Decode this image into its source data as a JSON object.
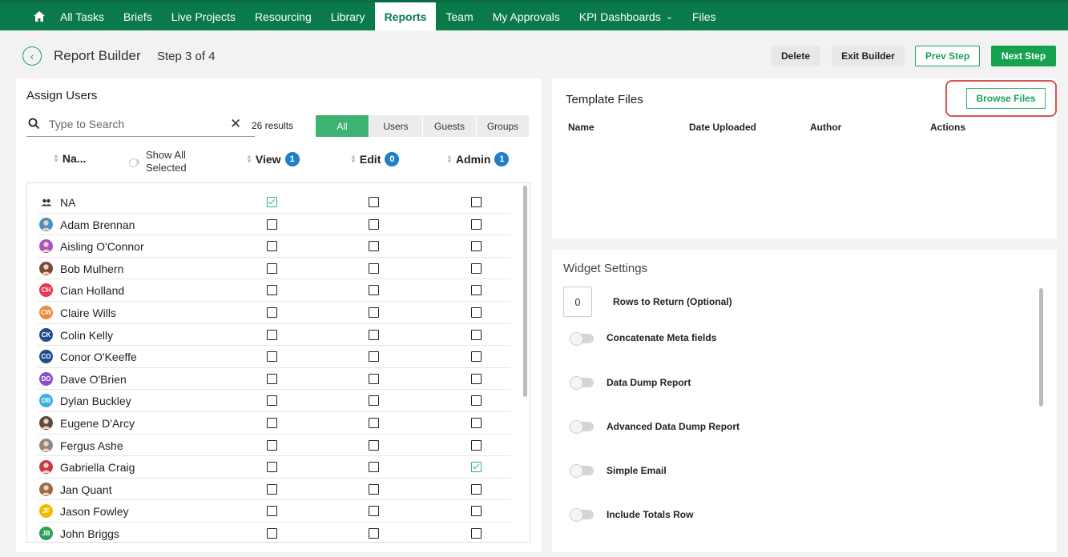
{
  "nav": {
    "home_icon": "home-icon",
    "items": [
      "All Tasks",
      "Briefs",
      "Live Projects",
      "Resourcing",
      "Library",
      "Reports",
      "Team",
      "My Approvals",
      "KPI Dashboards",
      "Files"
    ],
    "active": "Reports",
    "accent": "#0b7a4b"
  },
  "header": {
    "title": "Report Builder",
    "step": "Step 3 of 4",
    "delete_label": "Delete",
    "exit_label": "Exit Builder",
    "prev_label": "Prev Step",
    "next_label": "Next Step"
  },
  "assign": {
    "title": "Assign Users",
    "search_placeholder": "Type to Search",
    "results": "26 results",
    "filters": [
      "All",
      "Users",
      "Guests",
      "Groups"
    ],
    "columns": {
      "name": "Na...",
      "show_all": "Show All Selected",
      "view": "View",
      "view_count": "1",
      "edit": "Edit",
      "edit_count": "0",
      "admin": "Admin",
      "admin_count": "1"
    },
    "rows": [
      {
        "name": "NA",
        "initials": "",
        "color": "#444444",
        "group": true,
        "view": true,
        "edit": false,
        "admin": false
      },
      {
        "name": "Adam Brennan",
        "initials": "",
        "color": "#4a90c2",
        "view": false,
        "edit": false,
        "admin": false
      },
      {
        "name": "Aisling O'Connor",
        "initials": "",
        "color": "#a855c8",
        "view": false,
        "edit": false,
        "admin": false
      },
      {
        "name": "Bob Mulhern",
        "initials": "",
        "color": "#7a4b3a",
        "view": false,
        "edit": false,
        "admin": false
      },
      {
        "name": "Cian Holland",
        "initials": "CH",
        "color": "#e8384f",
        "view": false,
        "edit": false,
        "admin": false
      },
      {
        "name": "Claire Wills",
        "initials": "CW",
        "color": "#f0883e",
        "view": false,
        "edit": false,
        "admin": false
      },
      {
        "name": "Colin Kelly",
        "initials": "CK",
        "color": "#1e4f8c",
        "view": false,
        "edit": false,
        "admin": false
      },
      {
        "name": "Conor O'Keeffe",
        "initials": "CO",
        "color": "#1e4f8c",
        "view": false,
        "edit": false,
        "admin": false
      },
      {
        "name": "Dave O'Brien",
        "initials": "DO",
        "color": "#8a4fc8",
        "view": false,
        "edit": false,
        "admin": false
      },
      {
        "name": "Dylan Buckley",
        "initials": "DB",
        "color": "#3ab0e6",
        "view": false,
        "edit": false,
        "admin": false
      },
      {
        "name": "Eugene D'Arcy",
        "initials": "",
        "color": "#5a4a40",
        "view": false,
        "edit": false,
        "admin": false
      },
      {
        "name": "Fergus Ashe",
        "initials": "",
        "color": "#8a8a8a",
        "view": false,
        "edit": false,
        "admin": false
      },
      {
        "name": "Gabriella Craig",
        "initials": "",
        "color": "#c83a4a",
        "view": false,
        "edit": false,
        "admin": true
      },
      {
        "name": "Jan Quant",
        "initials": "",
        "color": "#9a6a4a",
        "view": false,
        "edit": false,
        "admin": false
      },
      {
        "name": "Jason Fowley",
        "initials": "JF",
        "color": "#f5b800",
        "view": false,
        "edit": false,
        "admin": false
      },
      {
        "name": "John Briggs",
        "initials": "JB",
        "color": "#2e9e58",
        "view": false,
        "edit": false,
        "admin": false
      }
    ]
  },
  "template": {
    "title": "Template Files",
    "browse_label": "Browse Files",
    "columns": [
      "Name",
      "Date Uploaded",
      "Author",
      "Actions"
    ]
  },
  "widget": {
    "title": "Widget Settings",
    "rows_value": "0",
    "rows_label": "Rows to Return (Optional)",
    "toggles": [
      "Concatenate Meta fields",
      "Data Dump Report",
      "Advanced Data Dump Report",
      "Simple Email",
      "Include Totals Row"
    ]
  }
}
